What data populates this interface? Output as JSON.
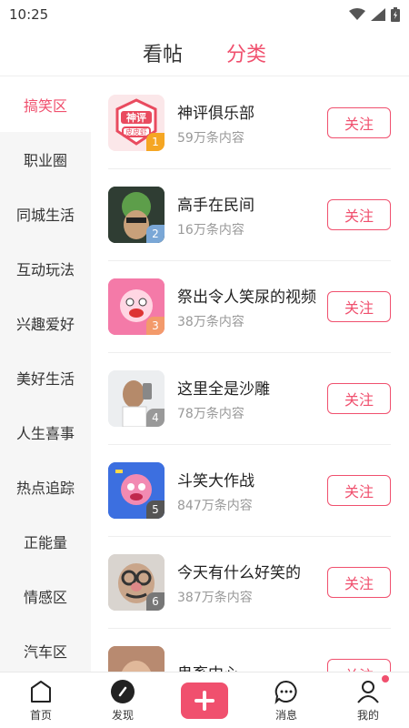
{
  "status": {
    "time": "10:25"
  },
  "tabs": [
    {
      "label": "看帖"
    },
    {
      "label": "分类"
    }
  ],
  "sidebar": {
    "items": [
      {
        "label": "搞笑区"
      },
      {
        "label": "职业圈"
      },
      {
        "label": "同城生活"
      },
      {
        "label": "互动玩法"
      },
      {
        "label": "兴趣爱好"
      },
      {
        "label": "美好生活"
      },
      {
        "label": "人生喜事"
      },
      {
        "label": "热点追踪"
      },
      {
        "label": "正能量"
      },
      {
        "label": "情感区"
      },
      {
        "label": "汽车区"
      }
    ]
  },
  "communities": [
    {
      "rank": "1",
      "title": "神评俱乐部",
      "count": "59万条内容",
      "follow": "关注"
    },
    {
      "rank": "2",
      "title": "高手在民间",
      "count": "16万条内容",
      "follow": "关注"
    },
    {
      "rank": "3",
      "title": "祭出令人笑尿的视频",
      "count": "38万条内容",
      "follow": "关注"
    },
    {
      "rank": "4",
      "title": "这里全是沙雕",
      "count": "78万条内容",
      "follow": "关注"
    },
    {
      "rank": "5",
      "title": "斗笑大作战",
      "count": "847万条内容",
      "follow": "关注"
    },
    {
      "rank": "6",
      "title": "今天有什么好笑的",
      "count": "387万条内容",
      "follow": "关注"
    },
    {
      "rank": "",
      "title": "鬼畜中心",
      "count": "",
      "follow": "关注"
    }
  ],
  "thumb_logo_text": {
    "top": "神评",
    "bottom": "皮皮虾"
  },
  "bottom_nav": {
    "home": "首页",
    "discover": "发现",
    "messages": "消息",
    "mine": "我的"
  },
  "colors": {
    "accent": "#f0506e"
  }
}
